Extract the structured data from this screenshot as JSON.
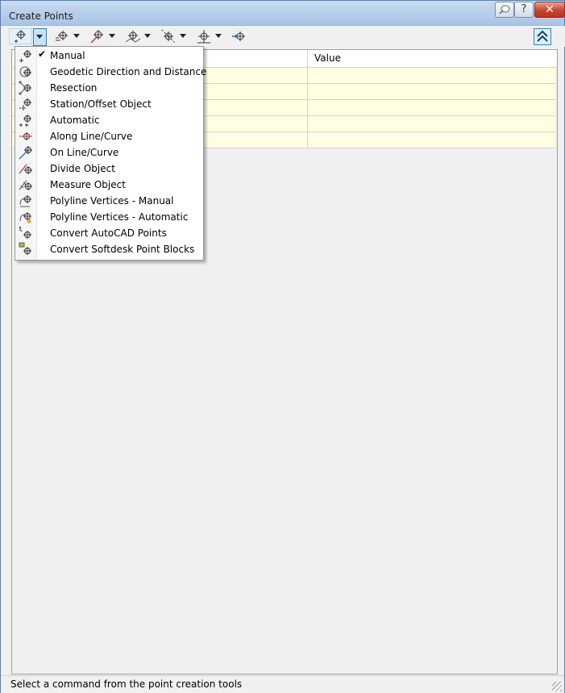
{
  "window": {
    "title": "Create Points",
    "buttons": {
      "pin": "pin-icon",
      "help": "?",
      "close": "✕"
    }
  },
  "toolbar": {
    "tools": [
      {
        "icon": "manual-point-icon"
      },
      {
        "icon": "intersection-point-icon"
      },
      {
        "icon": "alignment-point-icon"
      },
      {
        "icon": "surface-point-icon"
      },
      {
        "icon": "interpolate-point-icon"
      },
      {
        "icon": "slope-point-icon"
      },
      {
        "icon": "import-points-icon"
      }
    ],
    "collapse_icon": "double-chevron-up-icon"
  },
  "grid": {
    "columns": [
      "",
      "Value"
    ],
    "rows": [
      [
        "",
        ""
      ],
      [
        "",
        ""
      ],
      [
        "",
        ""
      ],
      [
        "",
        ""
      ],
      [
        "",
        ""
      ]
    ]
  },
  "menu": {
    "items": [
      {
        "label": "Manual",
        "checked": true,
        "icon": "manual-icon"
      },
      {
        "label": "Geodetic Direction and Distance",
        "checked": false,
        "icon": "geodetic-icon"
      },
      {
        "label": "Resection",
        "checked": false,
        "icon": "resection-icon"
      },
      {
        "label": "Station/Offset Object",
        "checked": false,
        "icon": "station-offset-icon"
      },
      {
        "label": "Automatic",
        "checked": false,
        "icon": "automatic-icon"
      },
      {
        "label": "Along Line/Curve",
        "checked": false,
        "icon": "along-line-icon"
      },
      {
        "label": "On Line/Curve",
        "checked": false,
        "icon": "on-line-icon"
      },
      {
        "label": "Divide Object",
        "checked": false,
        "icon": "divide-icon"
      },
      {
        "label": "Measure Object",
        "checked": false,
        "icon": "measure-icon"
      },
      {
        "label": "Polyline Vertices - Manual",
        "checked": false,
        "icon": "polyline-manual-icon"
      },
      {
        "label": "Polyline Vertices - Automatic",
        "checked": false,
        "icon": "polyline-auto-icon"
      },
      {
        "label": "Convert AutoCAD Points",
        "checked": false,
        "icon": "convert-autocad-icon"
      },
      {
        "label": "Convert Softdesk Point Blocks",
        "checked": false,
        "icon": "convert-softdesk-icon"
      }
    ],
    "check_glyph": "✔"
  },
  "status": {
    "text": "Select a command from the point creation tools"
  }
}
